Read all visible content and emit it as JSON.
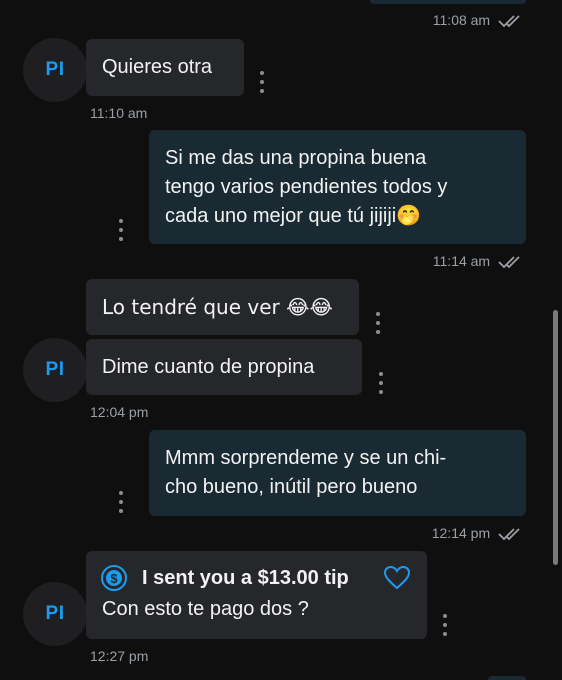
{
  "avatar_initials": "PI",
  "messages": [
    {
      "time": "11:08 am"
    },
    {
      "text": "Quieres otra",
      "time": "11:10 am"
    },
    {
      "lines": [
        "Si me das una propina buena",
        "tengo varios pendientes todos y",
        "cada uno mejor que tú jijiji🤭"
      ],
      "time": "11:14 am"
    },
    {
      "text": "Lo tendré que ver 😂😂"
    },
    {
      "text": "Dime cuanto de propina",
      "time": "12:04 pm"
    },
    {
      "lines": [
        "Mmm sorprendeme y se un chi-",
        "cho bueno, inútil pero bueno"
      ],
      "time": "12:14 pm"
    },
    {
      "tip_label": "I sent you a $13.00 tip",
      "text": "Con esto te pago dos ?",
      "time": "12:27 pm"
    }
  ],
  "colors": {
    "background": "#0f0f10",
    "incoming_bubble": "#25272b",
    "outgoing_bubble": "#1a2a33",
    "accent": "#1d9bf0"
  },
  "icons": [
    "double-check-icon",
    "more-options-icon",
    "dollar-coin-icon",
    "heart-icon"
  ]
}
